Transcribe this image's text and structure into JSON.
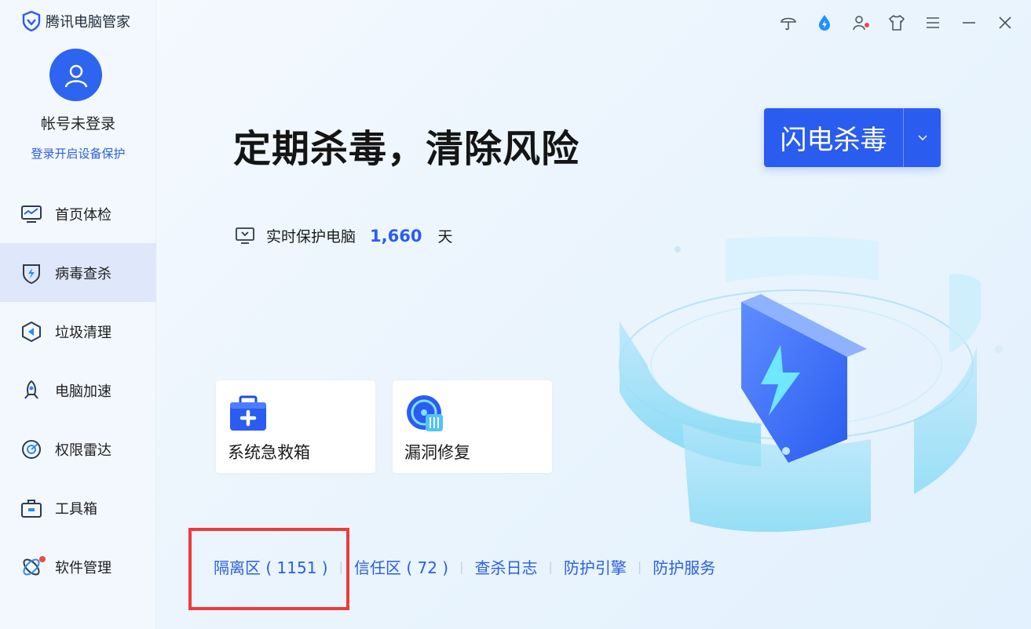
{
  "app": {
    "name": "腾讯电脑管家"
  },
  "account": {
    "name": "帐号未登录",
    "login_link": "登录开启设备保护"
  },
  "sidebar": {
    "items": [
      {
        "label": "首页体检",
        "icon": "monitor-pulse-icon",
        "active": false
      },
      {
        "label": "病毒查杀",
        "icon": "shield-bolt-icon",
        "active": true
      },
      {
        "label": "垃圾清理",
        "icon": "broom-icon",
        "active": false
      },
      {
        "label": "电脑加速",
        "icon": "rocket-icon",
        "active": false
      },
      {
        "label": "权限雷达",
        "icon": "radar-icon",
        "active": false
      },
      {
        "label": "工具箱",
        "icon": "toolbox-icon",
        "active": false
      },
      {
        "label": "软件管理",
        "icon": "software-icon",
        "active": false,
        "badge": true
      }
    ]
  },
  "topbar": {
    "icons": [
      "umbrella-icon",
      "droplet-bolt-icon",
      "user-settings-icon",
      "skin-shirt-icon",
      "menu-icon",
      "minimize-icon",
      "close-icon"
    ]
  },
  "main": {
    "headline": "定期杀毒，清除风险",
    "scan_button": "闪电杀毒",
    "protect_label": "实时保护电脑",
    "protect_days": "1,660",
    "protect_unit": "天",
    "cards": [
      {
        "label": "系统急救箱",
        "icon": "first-aid-kit-icon"
      },
      {
        "label": "漏洞修复",
        "icon": "vulnerability-fix-icon"
      }
    ],
    "links": [
      {
        "label": "隔离区 ( 1151 )"
      },
      {
        "label": "信任区 ( 72 )"
      },
      {
        "label": "查杀日志"
      },
      {
        "label": "防护引擎"
      },
      {
        "label": "防护服务"
      }
    ]
  },
  "colors": {
    "accent": "#2a5cf0",
    "link": "#2a5fe0",
    "highlight": "#ee3a3a"
  }
}
